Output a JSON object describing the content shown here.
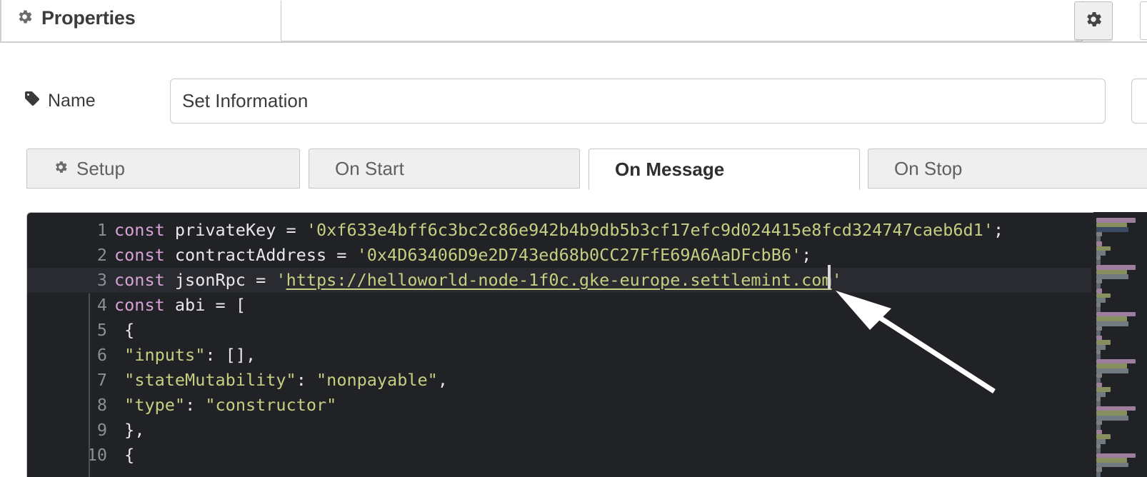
{
  "header": {
    "panel_title": "Properties",
    "gear_icon": "gear-icon",
    "gear_button_label": "⚙"
  },
  "name_row": {
    "label": "Name",
    "tag_icon": "tag-icon",
    "value": "Set Information",
    "placeholder": "Name"
  },
  "tabs": [
    {
      "label": "Setup",
      "icon": "gear-icon",
      "active": false
    },
    {
      "label": "On Start",
      "icon": "",
      "active": false
    },
    {
      "label": "On Message",
      "icon": "",
      "active": true
    },
    {
      "label": "On Stop",
      "icon": "",
      "active": false
    }
  ],
  "editor": {
    "active_line": 3,
    "lines": [
      {
        "n": "1",
        "text": "const privateKey = '0xf633e4bff6c3bc2c86e942b4b9db5b3cf17efc9d024415e8fcd324747caeb6d1';"
      },
      {
        "n": "2",
        "text": "const contractAddress = '0x4D63406D9e2D743ed68b0CC27FfE69A6AaDFcbB6';"
      },
      {
        "n": "3",
        "text": "const jsonRpc = 'https://helloworld-node-1f0c.gke-europe.settlemint.com'"
      },
      {
        "n": "4",
        "text": "const abi = ["
      },
      {
        "n": "5",
        "text": " {"
      },
      {
        "n": "6",
        "text": " \"inputs\": [],"
      },
      {
        "n": "7",
        "text": " \"stateMutability\": \"nonpayable\","
      },
      {
        "n": "8",
        "text": " \"type\": \"constructor\""
      },
      {
        "n": "9",
        "text": " },"
      },
      {
        "n": "10",
        "text": " {"
      }
    ],
    "line_numbers": [
      "1",
      "2",
      "3",
      "4",
      "5",
      "6",
      "7",
      "8",
      "9",
      "10"
    ],
    "line3_url": "https://helloworld-node-1f0c.gke-europe.settlemint.com",
    "colors": {
      "background": "#212226",
      "current_line": "#2a2b31",
      "keyword": "#d6a2d6",
      "string": "#c3d082",
      "identifier": "#e9e9e9",
      "line_number": "#8b8f94"
    }
  },
  "annotation": {
    "type": "arrow",
    "color": "#ffffff",
    "points_to": "end-of-jsonrpc-url"
  }
}
